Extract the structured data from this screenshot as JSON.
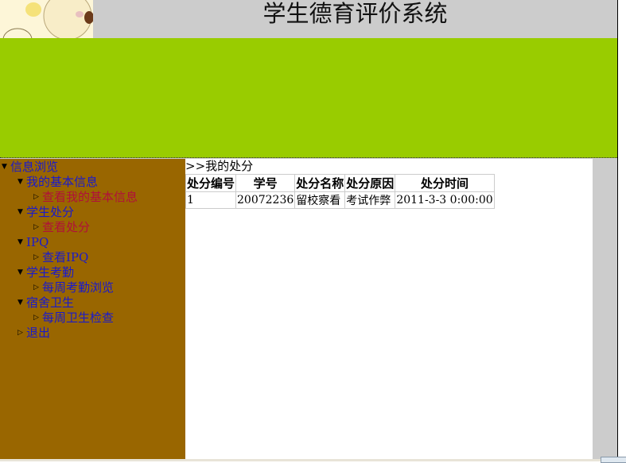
{
  "header": {
    "title": "学生德育评价系统"
  },
  "sidebar": {
    "items": [
      {
        "label": "信息浏览",
        "level": 0,
        "expanded": true
      },
      {
        "label": "我的基本信息",
        "level": 1,
        "expanded": true
      },
      {
        "label": "查看我的基本信息",
        "level": 2,
        "visited": true
      },
      {
        "label": "学生处分",
        "level": 1,
        "expanded": true
      },
      {
        "label": "查看处分",
        "level": 2,
        "visited": true
      },
      {
        "label": "IPQ",
        "level": 1,
        "expanded": true
      },
      {
        "label": "查看IPQ",
        "level": 2
      },
      {
        "label": "学生考勤",
        "level": 1,
        "expanded": true
      },
      {
        "label": "每周考勤浏览",
        "level": 2
      },
      {
        "label": "宿舍卫生",
        "level": 1,
        "expanded": true
      },
      {
        "label": "每周卫生检查",
        "level": 2
      },
      {
        "label": "退出",
        "level": 1,
        "expanded": false
      }
    ]
  },
  "main": {
    "breadcrumb": ">>我的处分",
    "table": {
      "headers": [
        "处分编号",
        "学号",
        "处分名称",
        "处分原因",
        "处分时间"
      ],
      "rows": [
        [
          "1",
          "20072236",
          "留校察看",
          "考试作弊",
          "2011-3-3 0:00:00"
        ]
      ]
    }
  },
  "colors": {
    "header": "#cccccc",
    "band": "#99cc00",
    "sidebar": "#996600",
    "link": "#1a1acc",
    "visited": "#b0103a"
  }
}
